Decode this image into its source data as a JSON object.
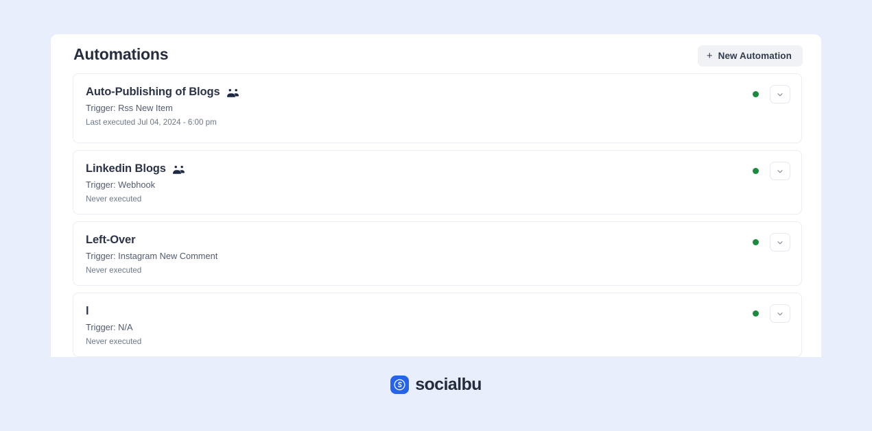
{
  "theme": {
    "page_background": "#e9eefc",
    "panel_background": "#ffffff",
    "accent": "#2563eb",
    "status_active": "#1a8a3c",
    "title_color": "#252d3f"
  },
  "header": {
    "title": "Automations",
    "new_button": {
      "label": "New Automation",
      "plus_glyph": "+",
      "icon_name": "plus-icon"
    }
  },
  "automations": [
    {
      "title": "Auto-Publishing of Blogs",
      "has_group_icon": true,
      "group_icon_name": "users-group-icon",
      "trigger": "Trigger: Rss New Item",
      "last_executed": "Last executed Jul 04, 2024 - 6:00 pm",
      "status": "active",
      "status_icon_name": "status-dot-active",
      "expand_icon_name": "chevron-down-icon"
    },
    {
      "title": "Linkedin Blogs",
      "has_group_icon": true,
      "group_icon_name": "users-group-icon",
      "trigger": "Trigger: Webhook",
      "last_executed": "Never executed",
      "status": "active",
      "status_icon_name": "status-dot-active",
      "expand_icon_name": "chevron-down-icon"
    },
    {
      "title": "Left-Over",
      "has_group_icon": false,
      "group_icon_name": "users-group-icon",
      "trigger": "Trigger: Instagram New Comment",
      "last_executed": "Never executed",
      "status": "active",
      "status_icon_name": "status-dot-active",
      "expand_icon_name": "chevron-down-icon"
    },
    {
      "title": "l",
      "has_group_icon": false,
      "group_icon_name": "users-group-icon",
      "trigger": "Trigger: N/A",
      "last_executed": "Never executed",
      "status": "active",
      "status_icon_name": "status-dot-active",
      "expand_icon_name": "chevron-down-icon"
    }
  ],
  "footer": {
    "brand": "socialbu",
    "logo_icon_name": "socialbu-logo-icon"
  }
}
